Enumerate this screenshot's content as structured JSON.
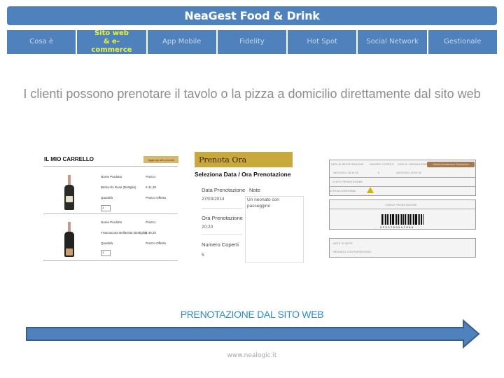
{
  "header": {
    "title": "NeaGest Food & Drink"
  },
  "nav": {
    "items": [
      {
        "label": "Cosa è",
        "active": false
      },
      {
        "label": "Sito web  & e-commerce",
        "active": true
      },
      {
        "label": "App Mobile",
        "active": false
      },
      {
        "label": "Fidelity",
        "active": false
      },
      {
        "label": "Hot Spot",
        "active": false
      },
      {
        "label": "Social Network",
        "active": false
      },
      {
        "label": "Gestionale",
        "active": false
      }
    ],
    "active_color": "#e6f53a",
    "bar_color": "#4f81bd"
  },
  "intro": {
    "text": "I clienti possono prenotare il tavolo o la pizza a domicilio direttamente dal sito web"
  },
  "cart": {
    "title": "IL MIO CARRELLO",
    "button": "Aggiungi altri prodotti",
    "items": [
      {
        "name_label": "Nome Prodotto",
        "price_label": "Prezzo",
        "name": "Berlucchi Rosé (Bottiglia)",
        "price": "€ 41,30",
        "qty_label": "Quantità",
        "offer_label": "Prezzo Offerta",
        "qty": "1"
      },
      {
        "name_label": "Nome Prodotto",
        "price_label": "Prezzo",
        "name": "Franciacorta Bellavista (Bottiglia)",
        "price": "€ 46,20",
        "qty_label": "Quantità",
        "offer_label": "Prezzo Offerta",
        "qty": "1"
      }
    ]
  },
  "reservation": {
    "header": "Prenota Ora",
    "subtitle": "Seleziona Data / Ora Prenotazione",
    "date_label": "Data Prenotazione",
    "date_value": "27/03/2014",
    "note_label": "Note",
    "note_value": "Un neonato con passeggino",
    "time_label": "Ora Prenotazione",
    "time_value": "20:20",
    "covers_label": "Numero Coperti",
    "covers_value": "5"
  },
  "ticket": {
    "col1": "DATA DI REGISTRAZIONE",
    "col2": "NUMERO COPERTI",
    "col3": "DATA DI ORDINAZIONE",
    "badge": "Richiedi Annullamento Prenotazione",
    "val1": "26/03/2014 18:10:00",
    "val2": "5",
    "val3": "26/03/2014 20:20:00",
    "status_title": "STATO PRENOTAZIONE",
    "status_value": "ATTESA CONFERMA",
    "code_title": "CODICE PRENOTAZIONE",
    "barcode_number": "0 0 3 3 7 8 9 0 0 2 8 8 6",
    "note_title": "NOTE CLIENTE",
    "note_value": "NEONATO CON PASSEGGINO"
  },
  "caption": "PRENOTAZIONE DAL SITO WEB",
  "footer": "www.nealogic.it"
}
